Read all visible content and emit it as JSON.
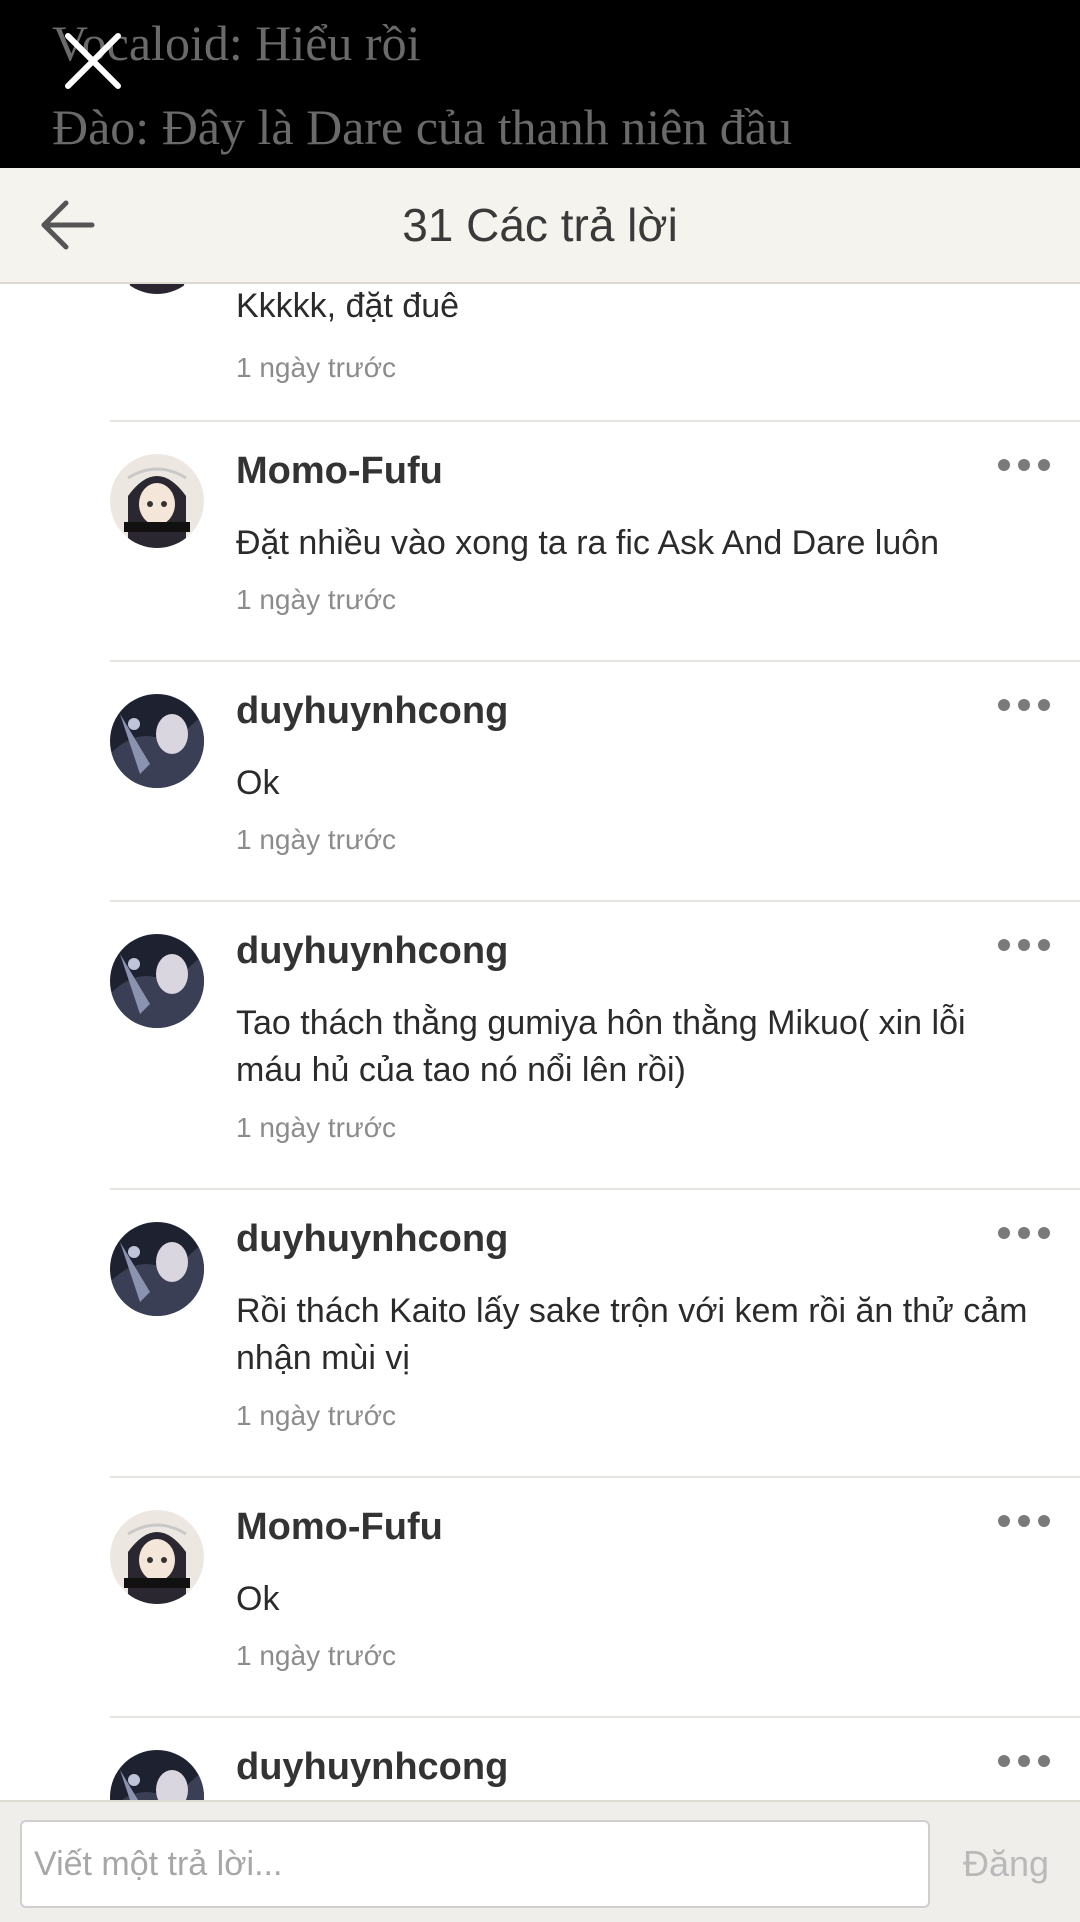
{
  "background_story": {
    "line1": "Vocaloid: Hiểu rồi",
    "line2": "Đào: Đây là Dare của thanh niên đầu"
  },
  "header": {
    "title": "31 Các trả lời"
  },
  "replies": [
    {
      "username": "",
      "text": "Kkkkk, đặt đuê",
      "time": "1 ngày trước",
      "avatar": "anime-girl"
    },
    {
      "username": "Momo-Fufu",
      "text": "Đặt nhiều vào xong ta ra fic Ask And Dare luôn",
      "time": "1 ngày trước",
      "avatar": "anime-girl"
    },
    {
      "username": "duyhuynhcong",
      "text": "Ok",
      "time": "1 ngày trước",
      "avatar": "dark-anime"
    },
    {
      "username": "duyhuynhcong",
      "text": "Tao thách thằng gumiya hôn thằng Mikuo( xin lỗi máu hủ của tao nó nổi lên rồi)",
      "time": "1 ngày trước",
      "avatar": "dark-anime"
    },
    {
      "username": "duyhuynhcong",
      "text": "Rồi thách Kaito lấy sake trộn với kem rồi ăn thử cảm nhận mùi vị",
      "time": "1 ngày trước",
      "avatar": "dark-anime"
    },
    {
      "username": "Momo-Fufu",
      "text": "Ok",
      "time": "1 ngày trước",
      "avatar": "anime-girl"
    },
    {
      "username": "duyhuynhcong",
      "text": "",
      "time": "",
      "avatar": "dark-anime"
    }
  ],
  "composer": {
    "placeholder": "Viết một trả lời...",
    "post_label": "Đăng"
  },
  "colors": {
    "header_bg": "#f4f3ee",
    "separator": "#e6e4df",
    "muted_text": "#8c8c8c",
    "post_disabled": "#b9b9b9"
  }
}
